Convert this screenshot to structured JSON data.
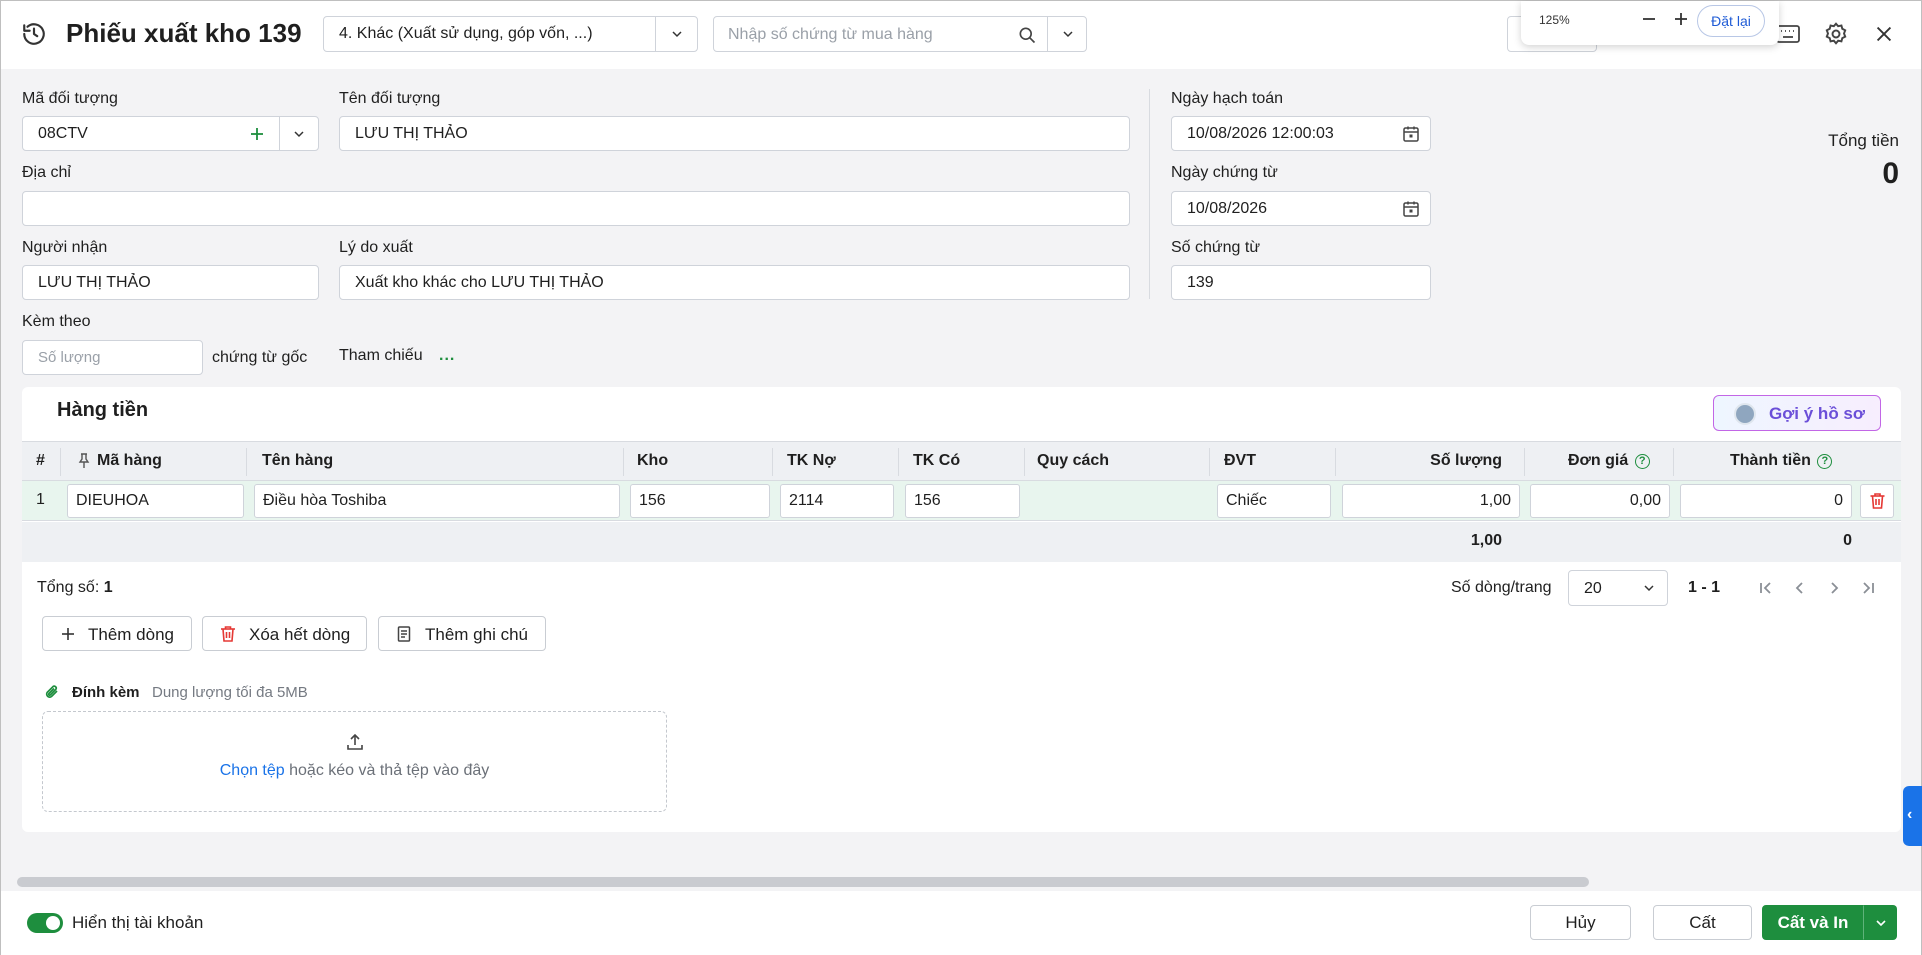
{
  "header": {
    "title": "Phiếu xuất kho 139",
    "voucher_type": "4. Khác (Xuất sử dụng, góp vốn, ...)",
    "search_placeholder": "Nhập số chứng từ mua hàng"
  },
  "zoom": {
    "level": "125%",
    "reset_label": "Đặt lại"
  },
  "form": {
    "ma_doi_tuong_label": "Mã đối tượng",
    "ma_doi_tuong": "08CTV",
    "ten_doi_tuong_label": "Tên đối tượng",
    "ten_doi_tuong": "LƯU THỊ THẢO",
    "dia_chi_label": "Địa chỉ",
    "dia_chi": "",
    "nguoi_nhan_label": "Người nhận",
    "nguoi_nhan": "LƯU THỊ THẢO",
    "ly_do_xuat_label": "Lý do xuất",
    "ly_do_xuat": "Xuất kho khác cho LƯU THỊ THẢO",
    "kem_theo_label": "Kèm theo",
    "so_luong_placeholder": "Số lượng",
    "chung_tu_goc_label": "chứng từ gốc",
    "tham_chieu_label": "Tham chiếu",
    "tham_chieu_more": "...",
    "ngay_hach_toan_label": "Ngày hạch toán",
    "ngay_hach_toan": "10/08/2026 12:00:03",
    "ngay_chung_tu_label": "Ngày chứng từ",
    "ngay_chung_tu": "10/08/2026",
    "so_chung_tu_label": "Số chứng từ",
    "so_chung_tu": "139",
    "tong_tien_label": "Tổng tiền",
    "tong_tien": "0"
  },
  "detail": {
    "section_title": "Hàng tiền",
    "suggest_label": "Gợi ý hồ sơ",
    "columns": {
      "num": "#",
      "ma_hang": "Mã hàng",
      "ten_hang": "Tên hàng",
      "kho": "Kho",
      "tk_no": "TK Nợ",
      "tk_co": "TK Có",
      "quy_cach": "Quy cách",
      "dvt": "ĐVT",
      "so_luong": "Số lượng",
      "don_gia": "Đơn giá",
      "thanh_tien": "Thành tiền"
    },
    "rows": [
      {
        "num": "1",
        "ma_hang": "DIEUHOA",
        "ten_hang": "Điều hòa Toshiba",
        "kho": "156",
        "tk_no": "2114",
        "tk_co": "156",
        "quy_cach": "",
        "dvt": "Chiếc",
        "so_luong": "1,00",
        "don_gia": "0,00",
        "thanh_tien": "0"
      }
    ],
    "totals": {
      "so_luong": "1,00",
      "thanh_tien": "0"
    }
  },
  "pagination": {
    "total_label": "Tổng số:",
    "total_value": "1",
    "rows_per_page_label": "Số dòng/trang",
    "rows_per_page": "20",
    "range": "1 - 1"
  },
  "actions": {
    "add_row": "Thêm dòng",
    "delete_all": "Xóa hết dòng",
    "add_note": "Thêm ghi chú"
  },
  "attachment": {
    "label": "Đính kèm",
    "note": "Dung lượng tối đa 5MB",
    "choose_file": "Chọn tệp",
    "drop_hint": " hoặc kéo và thả tệp vào đây"
  },
  "footer": {
    "show_account_label": "Hiển thị tài khoản",
    "cancel": "Hủy",
    "save": "Cất",
    "save_print": "Cất và In"
  },
  "colors": {
    "primary_green": "#1e8e3e",
    "link_blue": "#1a73e8",
    "delete_red": "#e53935",
    "row_highlight": "#e8f5ee"
  }
}
